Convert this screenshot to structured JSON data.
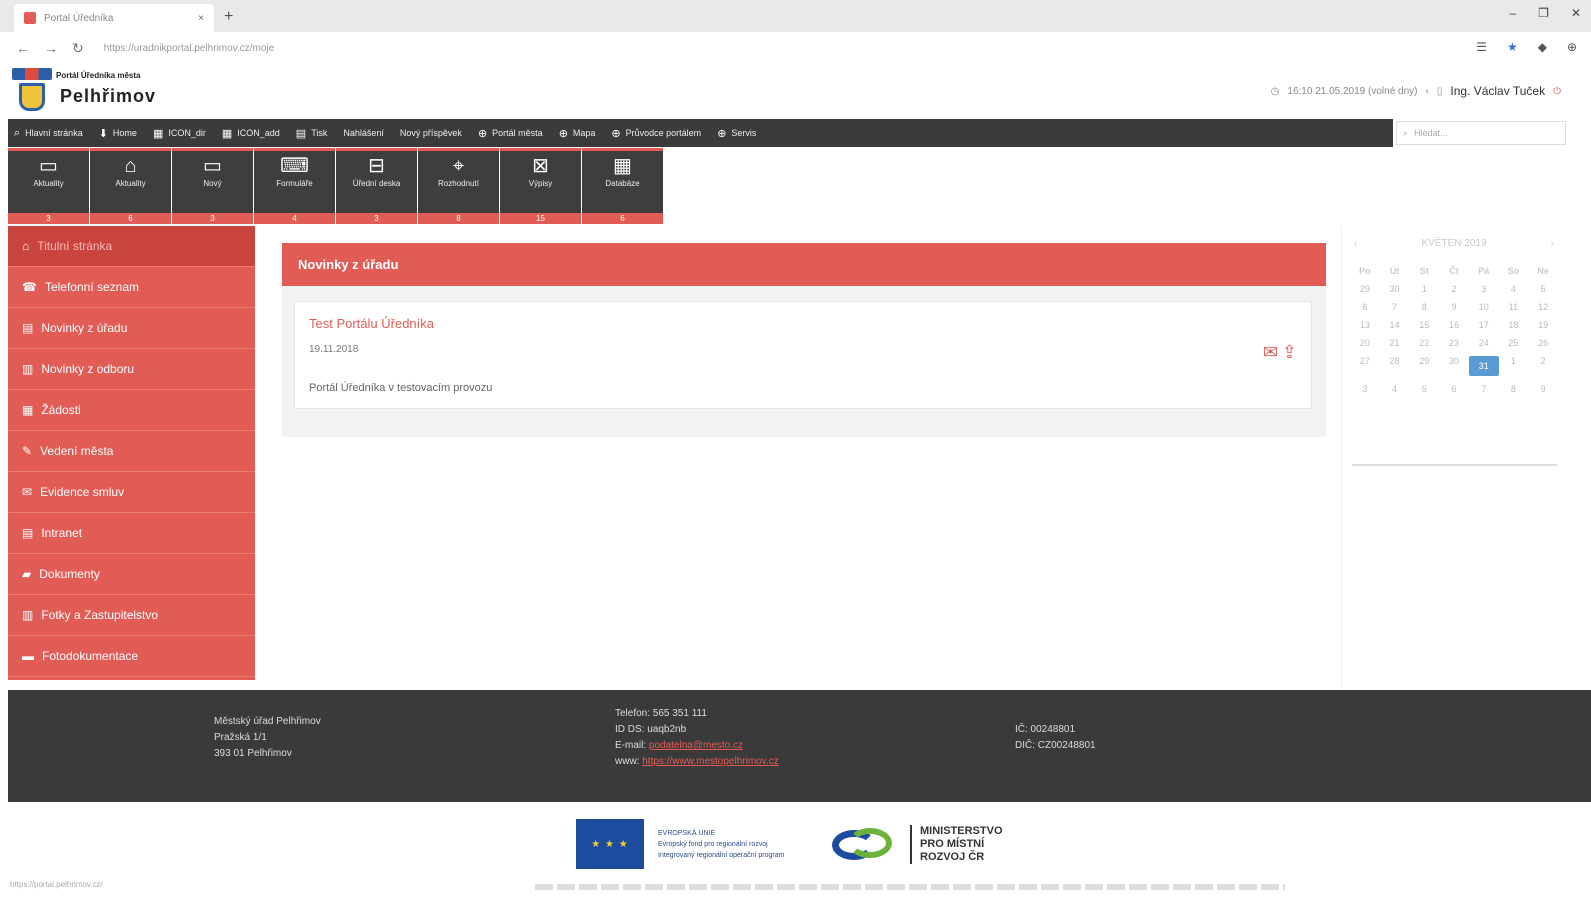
{
  "browser": {
    "tab_title": "Portal Úředníka",
    "tab_close": "×",
    "new_tab": "+",
    "url": "https://uradnikportal.pelhrimov.cz/moje",
    "win_controls": [
      "–",
      "❐",
      "✕"
    ],
    "nav_icons": [
      "←",
      "→",
      "↻"
    ],
    "right_icons": [
      "☰",
      "★",
      "◆",
      "⊕"
    ]
  },
  "header": {
    "portal_subtitle": "Portál Úředníka města",
    "city": "Pelhřimov",
    "date_info": "16:10 21.05.2019 (volné dny)",
    "user": "Ing. Václav Tuček",
    "user_icon": "person-icon"
  },
  "topmenu": [
    {
      "icon": "⌕",
      "label": "Hlavní stránka"
    },
    {
      "icon": "⬇",
      "label": "Home"
    },
    {
      "icon": "▦",
      "label": "ICON_dir"
    },
    {
      "icon": "▦",
      "label": "ICON_add"
    },
    {
      "icon": "▤",
      "label": "Tisk"
    },
    {
      "icon": "",
      "label": "Nahlášení"
    },
    {
      "icon": "",
      "label": "Nový příspěvek"
    },
    {
      "icon": "⊕",
      "label": "Portál města"
    },
    {
      "icon": "⊕",
      "label": "Mapa"
    },
    {
      "icon": "⊕",
      "label": "Průvodce portálem"
    },
    {
      "icon": "⊕",
      "label": "Servis"
    }
  ],
  "search": {
    "placeholder": "Hledat..."
  },
  "tiles": [
    {
      "icon": "▭",
      "label": "Aktuality",
      "badge": "3"
    },
    {
      "icon": "⌂",
      "label": "Aktuality",
      "badge": "6"
    },
    {
      "icon": "▭",
      "label": "Nový",
      "badge": "3"
    },
    {
      "icon": "⌨",
      "label": "Formuláře",
      "badge": "4"
    },
    {
      "icon": "⊟",
      "label": "Úřední deska",
      "badge": "3"
    },
    {
      "icon": "⌖",
      "label": "Rozhodnutí",
      "badge": "8"
    },
    {
      "icon": "⊠",
      "label": "Výpisy",
      "badge": "15"
    },
    {
      "icon": "▦",
      "label": "Databáze",
      "badge": "6"
    }
  ],
  "sidebar": [
    {
      "icon": "⌂",
      "label": "Titulní stránka",
      "active": true
    },
    {
      "icon": "☎",
      "label": "Telefonní seznam"
    },
    {
      "icon": "▤",
      "label": "Novinky z úřadu"
    },
    {
      "icon": "▥",
      "label": "Novinky z odboru"
    },
    {
      "icon": "▦",
      "label": "Žádosti"
    },
    {
      "icon": "✎",
      "label": "Vedení města"
    },
    {
      "icon": "✉",
      "label": "Evidence smluv"
    },
    {
      "icon": "▤",
      "label": "Intranet"
    },
    {
      "icon": "▰",
      "label": "Dokumenty"
    },
    {
      "icon": "▥",
      "label": "Fotky a Zastupitelstvo"
    },
    {
      "icon": "▬",
      "label": "Fotodokumentace"
    }
  ],
  "news_panel": {
    "title": "Novinky z úřadu",
    "item_title": "Test Portálu Úředníka",
    "item_date": "19.11.2018",
    "item_body": "Portál Úředníka v testovacím provozu",
    "actions": [
      "✉",
      "⇪"
    ]
  },
  "calendar": {
    "prev": "‹",
    "month": "KVĚTEN 2019",
    "next": "›",
    "day_names": [
      "Po",
      "Út",
      "St",
      "Čt",
      "Pá",
      "So",
      "Ne"
    ],
    "days": [
      "29",
      "30",
      "1",
      "2",
      "3",
      "4",
      "5",
      "6",
      "7",
      "8",
      "9",
      "10",
      "11",
      "12",
      "13",
      "14",
      "15",
      "16",
      "17",
      "18",
      "19",
      "20",
      "21",
      "22",
      "23",
      "24",
      "25",
      "26",
      "27",
      "28",
      "29",
      "30",
      "31",
      "1",
      "2",
      "3",
      "4",
      "5",
      "6",
      "7",
      "8",
      "9"
    ],
    "today": "31"
  },
  "footer": {
    "col1": [
      "Městský úřad Pelhřimov",
      "Pražská 1/1 ",
      "393 01 Pelhřimov"
    ],
    "col2_phone": "Telefon: 565 351 111",
    "col2_datbox": "ID DS: uaqb2nb",
    "col2_email_label": "E-mail:",
    "col2_email": "podatelna@mesto.cz",
    "col2_www_label": "www:",
    "col2_www": "https://www.mestopelhrimov.cz",
    "col3": [
      "IČ: 00248801",
      "DIČ: CZ00248801"
    ]
  },
  "logos": {
    "eu_stars": "★ ★ ★",
    "eu_text": [
      "EVROPSKÁ UNIE",
      "Evropský fond pro regionální rozvoj",
      "Integrovaný regionální operační program"
    ],
    "ministry": [
      "MINISTERSTVO",
      "PRO MÍSTNÍ",
      "ROZVOJ ČR"
    ]
  },
  "status_url": "https://portal.pelhrimov.cz/"
}
